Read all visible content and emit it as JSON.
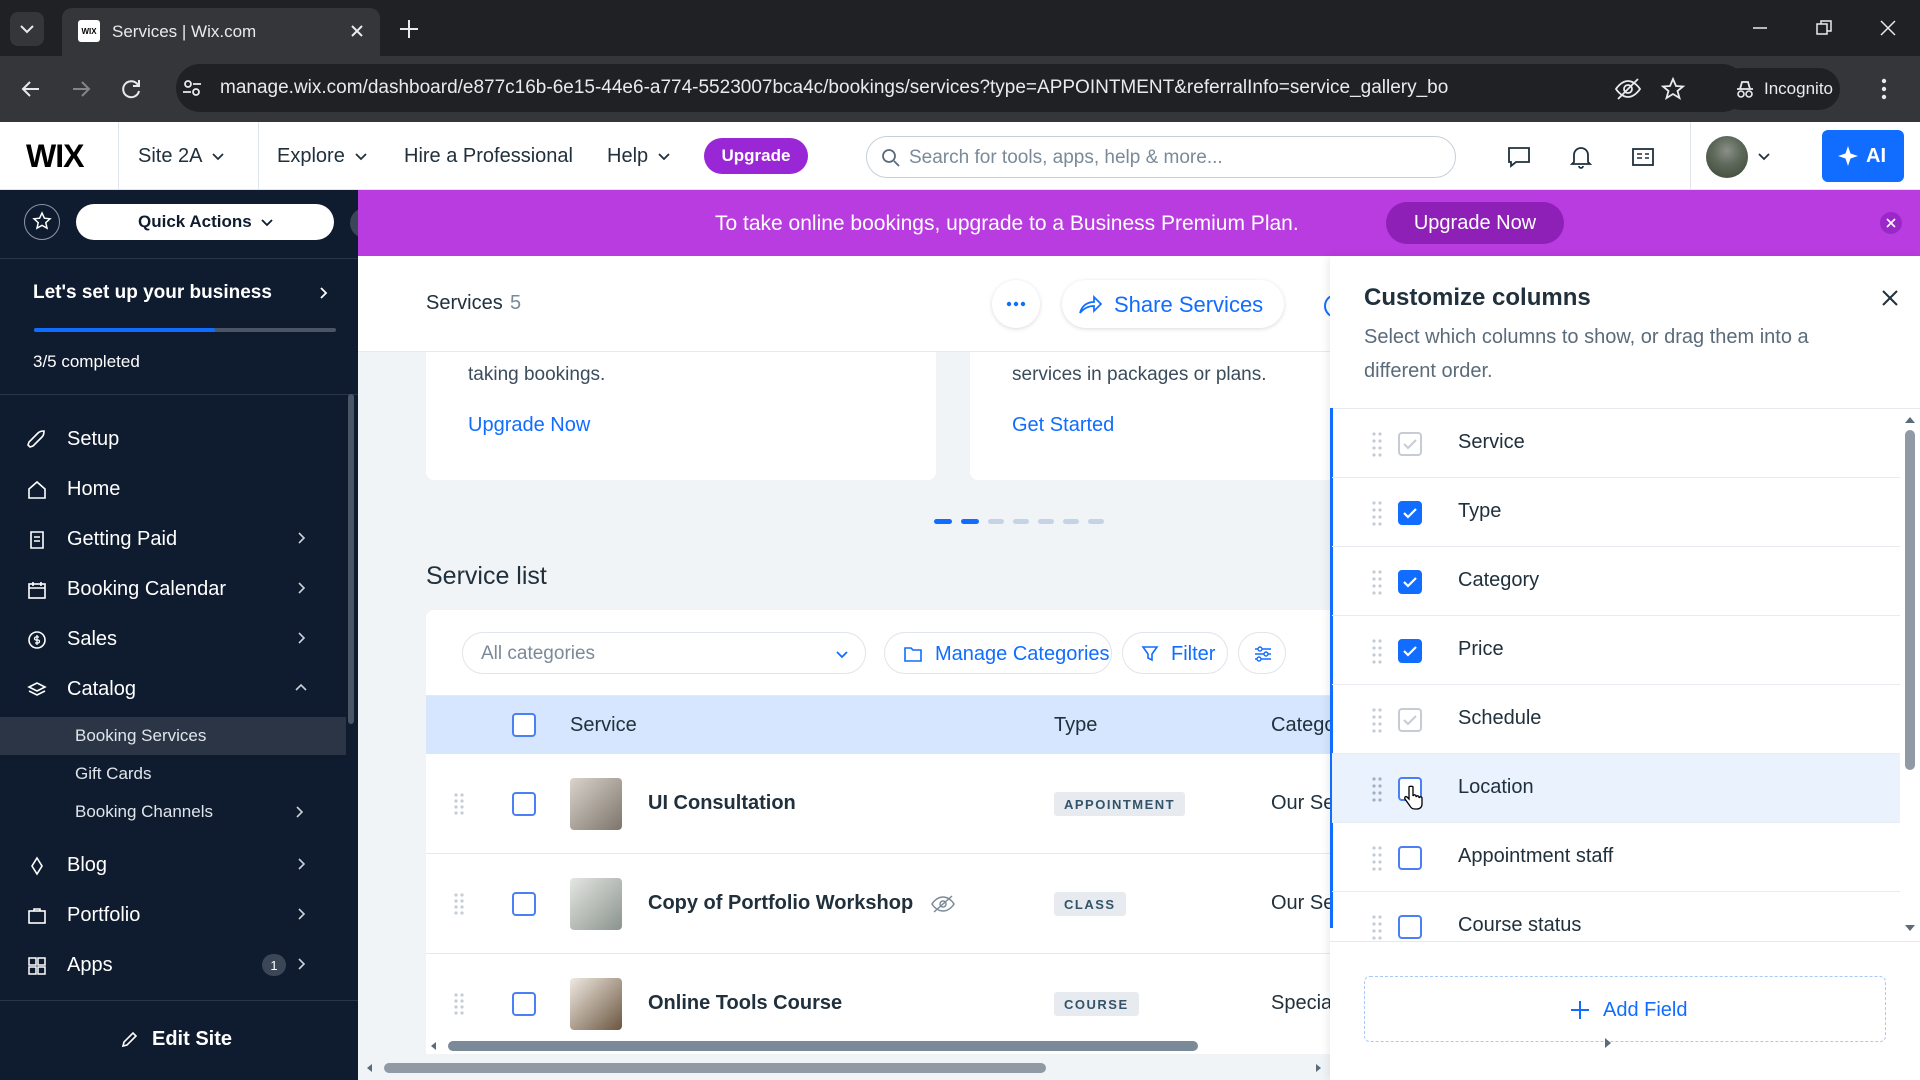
{
  "browser": {
    "tab_title": "Services | Wix.com",
    "url": "manage.wix.com/dashboard/e877c16b-6e15-44e6-a774-5523007bca4c/bookings/services?type=APPOINTMENT&referralInfo=service_gallery_bo",
    "incognito_label": "Incognito"
  },
  "wix_top": {
    "logo": "WIX",
    "site_name": "Site 2A",
    "explore": "Explore",
    "hire": "Hire a Professional",
    "help": "Help",
    "upgrade": "Upgrade",
    "search_placeholder": "Search for tools, apps, help & more...",
    "ai": "AI"
  },
  "sidebar": {
    "quick_actions": "Quick Actions",
    "setup_title": "Let's set up your business",
    "progress_text": "3/5 completed",
    "progress": 0.6,
    "items": [
      {
        "label": "Setup"
      },
      {
        "label": "Home"
      },
      {
        "label": "Getting Paid"
      },
      {
        "label": "Booking Calendar"
      },
      {
        "label": "Sales"
      },
      {
        "label": "Catalog"
      },
      {
        "label": "Blog"
      },
      {
        "label": "Portfolio"
      },
      {
        "label": "Apps",
        "badge": "1"
      }
    ],
    "catalog_sub": [
      {
        "label": "Booking Services"
      },
      {
        "label": "Gift Cards"
      },
      {
        "label": "Booking Channels"
      }
    ],
    "edit_site": "Edit Site"
  },
  "banner": {
    "text": "To take online bookings, upgrade to a Business Premium Plan.",
    "button": "Upgrade Now"
  },
  "main": {
    "title": "Services",
    "count": "5",
    "share": "Share Services",
    "card1_text": "taking bookings.",
    "card1_link": "Upgrade Now",
    "card2_text": "services in packages or plans.",
    "card2_link": "Get Started",
    "service_list_title": "Service list",
    "categories_placeholder": "All categories",
    "manage_categories": "Manage Categories",
    "filter": "Filter",
    "columns": {
      "service": "Service",
      "type": "Type",
      "category": "Catego"
    },
    "rows": [
      {
        "name": "UI Consultation",
        "type": "APPOINTMENT",
        "category": "Our Se"
      },
      {
        "name": "Copy of Portfolio Workshop",
        "type": "CLASS",
        "category": "Our Se"
      },
      {
        "name": "Online Tools Course",
        "type": "COURSE",
        "category": "Special"
      }
    ]
  },
  "panel": {
    "title": "Customize columns",
    "subtitle": "Select which columns to show, or drag them into a different order.",
    "items": [
      {
        "label": "Service",
        "state": "disabled-checked"
      },
      {
        "label": "Type",
        "state": "checked"
      },
      {
        "label": "Category",
        "state": "checked"
      },
      {
        "label": "Price",
        "state": "checked"
      },
      {
        "label": "Schedule",
        "state": "disabled-checked"
      },
      {
        "label": "Location",
        "state": "unchecked"
      },
      {
        "label": "Appointment staff",
        "state": "unchecked"
      },
      {
        "label": "Course status",
        "state": "unchecked"
      }
    ],
    "add_field": "Add Field"
  },
  "colors": {
    "accent": "#116dff",
    "sidebar_bg": "#0f1b2e",
    "banner": "#b93ce0",
    "upgrade": "#9a27d5"
  }
}
